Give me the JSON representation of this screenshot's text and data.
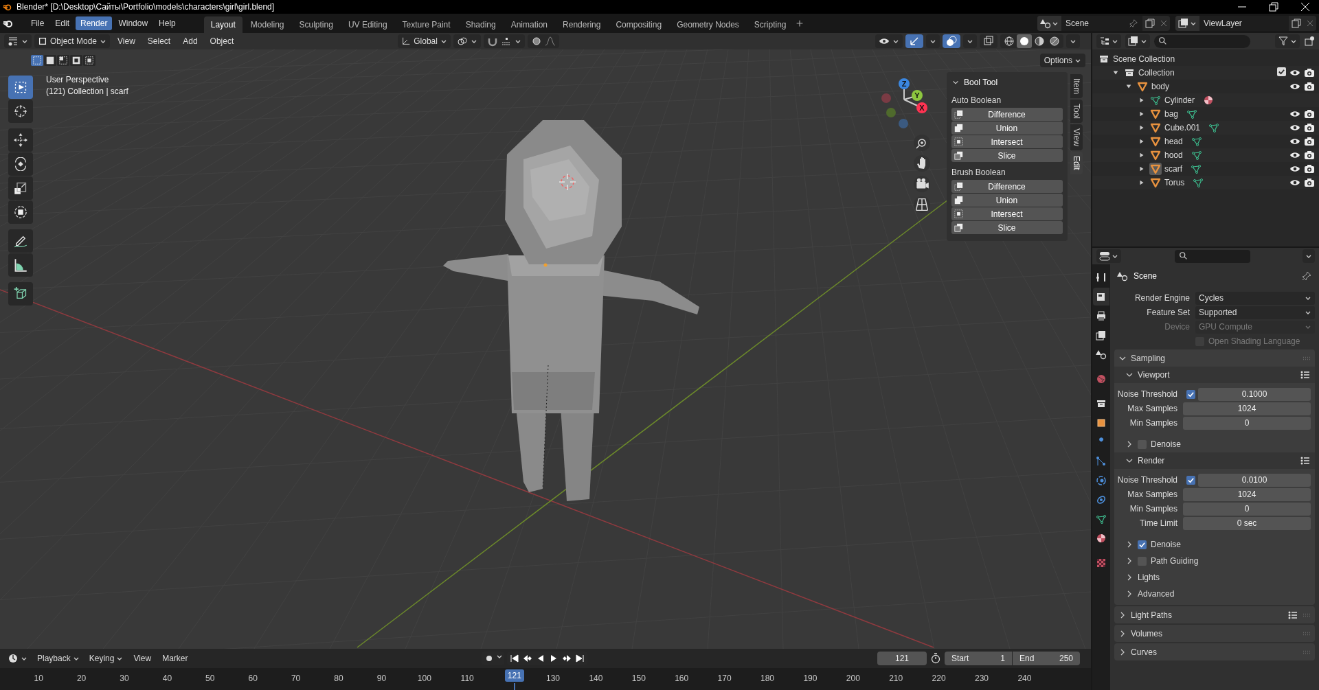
{
  "window": {
    "title": "Blender* [D:\\Desktop\\Сайты\\Portfolio\\models\\characters\\girl\\girl.blend]"
  },
  "menu": [
    {
      "label": "File",
      "selected": false
    },
    {
      "label": "Edit",
      "selected": false
    },
    {
      "label": "Render",
      "selected": true
    },
    {
      "label": "Window",
      "selected": false
    },
    {
      "label": "Help",
      "selected": false
    }
  ],
  "workspaces": [
    {
      "label": "Layout",
      "selected": true
    },
    {
      "label": "Modeling",
      "selected": false
    },
    {
      "label": "Sculpting",
      "selected": false
    },
    {
      "label": "UV Editing",
      "selected": false
    },
    {
      "label": "Texture Paint",
      "selected": false
    },
    {
      "label": "Shading",
      "selected": false
    },
    {
      "label": "Animation",
      "selected": false
    },
    {
      "label": "Rendering",
      "selected": false
    },
    {
      "label": "Compositing",
      "selected": false
    },
    {
      "label": "Geometry Nodes",
      "selected": false
    },
    {
      "label": "Scripting",
      "selected": false
    }
  ],
  "scene_field": {
    "value": "Scene"
  },
  "view_layer_field": {
    "value": "ViewLayer"
  },
  "viewport": {
    "mode": "Object Mode",
    "menus": [
      "View",
      "Select",
      "Add",
      "Object"
    ],
    "orientation": "Global",
    "options": "Options",
    "select_modes": [
      {
        "selected": true
      },
      {
        "selected": false
      },
      {
        "selected": false
      },
      {
        "selected": false
      },
      {
        "selected": false
      }
    ],
    "shading": [
      {
        "kind": "wireframe",
        "selected": false
      },
      {
        "kind": "solid",
        "selected": true
      },
      {
        "kind": "material",
        "selected": false
      },
      {
        "kind": "rendered",
        "selected": false
      }
    ],
    "overlay_text": [
      "User Perspective",
      "(121) Collection | scarf"
    ],
    "tools": [
      {
        "kind": "select",
        "selected": true
      },
      {
        "kind": "cursor",
        "selected": false
      },
      {
        "kind": "move",
        "selected": false
      },
      {
        "kind": "rotate",
        "selected": false
      },
      {
        "kind": "scale",
        "selected": false
      },
      {
        "kind": "transform",
        "selected": false
      },
      {
        "kind": "annotate",
        "selected": false
      },
      {
        "kind": "measure",
        "selected": false
      },
      {
        "kind": "add-cube",
        "selected": false
      }
    ],
    "gizmo_axes": [
      "Z",
      "Y",
      "X"
    ],
    "sidebar_tabs": [
      {
        "label": "Item",
        "selected": false
      },
      {
        "label": "Tool",
        "selected": false
      },
      {
        "label": "View",
        "selected": false
      },
      {
        "label": "Edit",
        "selected": true
      }
    ],
    "bool_tool": {
      "title": "Bool Tool",
      "groups": [
        {
          "title": "Auto Boolean",
          "buttons": [
            "Difference",
            "Union",
            "Intersect",
            "Slice"
          ]
        },
        {
          "title": "Brush Boolean",
          "buttons": [
            "Difference",
            "Union",
            "Intersect",
            "Slice"
          ]
        }
      ]
    }
  },
  "outliner": {
    "items": [
      {
        "name": "Scene Collection",
        "kind": "scene-collection",
        "selected": false,
        "children": [
          {
            "name": "Collection",
            "kind": "collection",
            "selected": false,
            "expanded": true,
            "checked": true,
            "children": [
              {
                "name": "body",
                "kind": "parent-object",
                "selected": false,
                "expanded": true,
                "children": [
                  {
                    "name": "Cylinder",
                    "kind": "mesh-data",
                    "selected": false,
                    "expanded": false
                  },
                  {
                    "name": "bag",
                    "kind": "mesh-object",
                    "selected": false,
                    "expanded": false
                  },
                  {
                    "name": "Cube.001",
                    "kind": "mesh-object",
                    "selected": false,
                    "expanded": false
                  },
                  {
                    "name": "head",
                    "kind": "mesh-object",
                    "selected": false,
                    "expanded": false
                  },
                  {
                    "name": "hood",
                    "kind": "mesh-object",
                    "selected": false,
                    "expanded": false
                  },
                  {
                    "name": "scarf",
                    "kind": "mesh-object",
                    "selected": true,
                    "expanded": false
                  },
                  {
                    "name": "Torus",
                    "kind": "mesh-object",
                    "selected": false,
                    "expanded": false
                  }
                ]
              }
            ]
          }
        ]
      }
    ]
  },
  "properties": {
    "title": "Scene",
    "tabs": [
      {
        "kind": "tool",
        "selected": false
      },
      {
        "kind": "render",
        "selected": true
      },
      {
        "kind": "output",
        "selected": false
      },
      {
        "kind": "view-layer",
        "selected": false
      },
      {
        "kind": "scene",
        "selected": false
      },
      {
        "kind": "world",
        "selected": false
      },
      {
        "kind": "collection",
        "selected": false
      },
      {
        "kind": "object",
        "selected": false
      },
      {
        "kind": "modifier",
        "selected": false
      },
      {
        "kind": "particles",
        "selected": false
      },
      {
        "kind": "physics",
        "selected": false
      },
      {
        "kind": "constraints",
        "selected": false
      },
      {
        "kind": "data",
        "selected": false
      },
      {
        "kind": "material",
        "selected": false
      },
      {
        "kind": "texture",
        "selected": false
      }
    ],
    "rows": [
      {
        "kind": "dropdown",
        "label": "Render Engine",
        "value": "Cycles",
        "disabled": false
      },
      {
        "kind": "dropdown",
        "label": "Feature Set",
        "value": "Supported",
        "disabled": false
      },
      {
        "kind": "dropdown",
        "label": "Device",
        "value": "GPU Compute",
        "disabled": true
      },
      {
        "kind": "checkbox",
        "label": "Open Shading Language",
        "checked": false,
        "disabled": true
      }
    ],
    "sections": [
      {
        "title": "Sampling",
        "expanded": true,
        "presets": false,
        "children": [
          {
            "title": "Viewport",
            "expanded": true,
            "presets": true,
            "rows": [
              {
                "label": "Noise Threshold",
                "checked": true,
                "value": "0.1000"
              },
              {
                "label": "Max Samples",
                "value": "1024"
              },
              {
                "label": "Min Samples",
                "value": "0"
              }
            ]
          },
          {
            "title": "Denoise",
            "expanded": false,
            "presets": false,
            "checked": false
          },
          {
            "title": "Render",
            "expanded": true,
            "presets": true,
            "rows": [
              {
                "label": "Noise Threshold",
                "checked": true,
                "value": "0.0100"
              },
              {
                "label": "Max Samples",
                "value": "1024"
              },
              {
                "label": "Min Samples",
                "value": "0"
              },
              {
                "label": "Time Limit",
                "value": "0 sec"
              }
            ]
          },
          {
            "title": "Denoise",
            "expanded": false,
            "presets": false,
            "checked": true
          },
          {
            "title": "Path Guiding",
            "expanded": false,
            "presets": false,
            "checked": false
          },
          {
            "title": "Lights",
            "expanded": false,
            "presets": false
          },
          {
            "title": "Advanced",
            "expanded": false,
            "presets": false
          }
        ]
      },
      {
        "title": "Light Paths",
        "expanded": false,
        "presets": true
      },
      {
        "title": "Volumes",
        "expanded": false,
        "presets": false
      },
      {
        "title": "Curves",
        "expanded": false,
        "presets": false
      }
    ]
  },
  "timeline": {
    "menus": [
      "Playback",
      "Keying",
      "View",
      "Marker"
    ],
    "frame": "121",
    "start_label": "Start",
    "start": "1",
    "end_label": "End",
    "end": "250",
    "ruler": [
      "10",
      "20",
      "30",
      "40",
      "50",
      "60",
      "70",
      "80",
      "90",
      "100",
      "110",
      "130",
      "140",
      "150",
      "160",
      "170",
      "180",
      "190",
      "200",
      "210",
      "220",
      "230",
      "240"
    ],
    "current_frame": "121"
  }
}
